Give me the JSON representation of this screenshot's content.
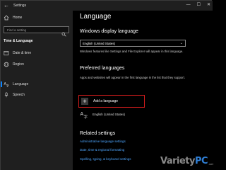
{
  "titlebar": {
    "title": "Settings"
  },
  "sidebar": {
    "home_label": "Home",
    "search_placeholder": "Find a setting",
    "section_title": "Time & Language",
    "items": [
      {
        "label": "Date & time",
        "icon": "calendar-clock-icon"
      },
      {
        "label": "Region",
        "icon": "globe-icon"
      },
      {
        "label": "Language",
        "icon": "language-icon",
        "active": true
      },
      {
        "label": "Speech",
        "icon": "microphone-icon"
      }
    ]
  },
  "main": {
    "title": "Language",
    "display_heading": "Windows display language",
    "display_value": "English (United States)",
    "display_note": "Windows features like Settings and File Explorer will appear in this language.",
    "preferred_heading": "Preferred languages",
    "preferred_note": "Apps and websites will appear in the first language in the list that they support.",
    "add_label": "Add a language",
    "installed": [
      {
        "name": "English (United States)"
      }
    ],
    "related_heading": "Related settings",
    "links": [
      "Administrative language settings",
      "Date, time & regional formatting",
      "Spelling, typing, & keyboard settings"
    ]
  },
  "watermark": {
    "text_main": "Variety",
    "text_accent": "PC",
    "suffix": ".net"
  },
  "colors": {
    "accent": "#0a84ff",
    "link": "#4ea6ff",
    "highlight": "#d01c1c",
    "background": "#000000",
    "sidebar": "#1f1f1f"
  }
}
